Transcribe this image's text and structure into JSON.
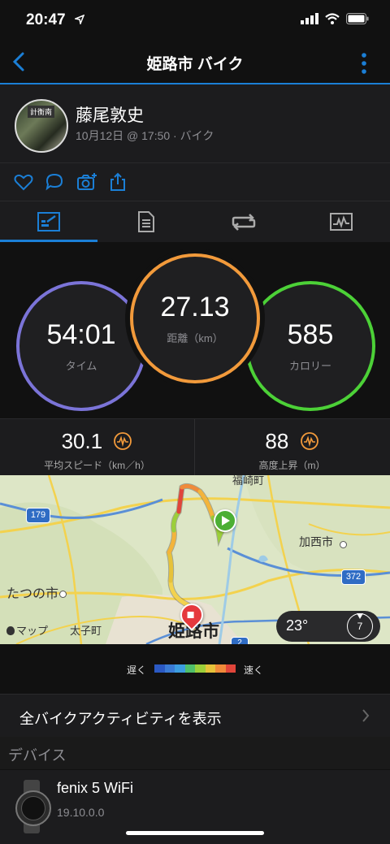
{
  "status": {
    "time": "20:47"
  },
  "nav": {
    "title": "姫路市 バイク"
  },
  "profile": {
    "name": "藤尾敦史",
    "subtitle": "10月12日 @ 17:50 · バイク",
    "avatar_text": "計衡南"
  },
  "actions": [
    "heart-icon",
    "comment-icon",
    "camera-add-icon",
    "share-icon"
  ],
  "tabs": [
    "overview-tab",
    "details-tab",
    "laps-tab",
    "charts-tab"
  ],
  "rings": {
    "time": {
      "value": "54:01",
      "label": "タイム",
      "color": "#7b74d8"
    },
    "distance": {
      "value": "27.13",
      "label": "距離（km）",
      "color": "#f29a3b"
    },
    "calories": {
      "value": "585",
      "label": "カロリー",
      "color": "#4cd137"
    }
  },
  "stats": {
    "speed": {
      "value": "30.1",
      "label": "平均スピード（km／h）"
    },
    "elev": {
      "value": "88",
      "label": "高度上昇（m）"
    }
  },
  "map": {
    "labels": {
      "fukusaki": "福崎町",
      "kasai": "加西市",
      "tatsuno": "たつの市",
      "taishi": "太子町",
      "himeji": "姫路市",
      "apple_maps": "マップ"
    },
    "routes": {
      "r179": "179",
      "r372": "372",
      "r2": "2"
    },
    "temperature": "23°",
    "wind": "7"
  },
  "legend": {
    "slow": "遅く",
    "fast": "速く",
    "colors": [
      "#2b59c3",
      "#3a7bd5",
      "#3c9de0",
      "#4fbf6a",
      "#9ccf3a",
      "#e6c23a",
      "#f08a3a",
      "#e0453a"
    ]
  },
  "links": {
    "all_activities": "全バイクアクティビティを表示"
  },
  "devices": {
    "heading": "デバイス",
    "name": "fenix 5 WiFi",
    "version": "19.10.0.0"
  }
}
